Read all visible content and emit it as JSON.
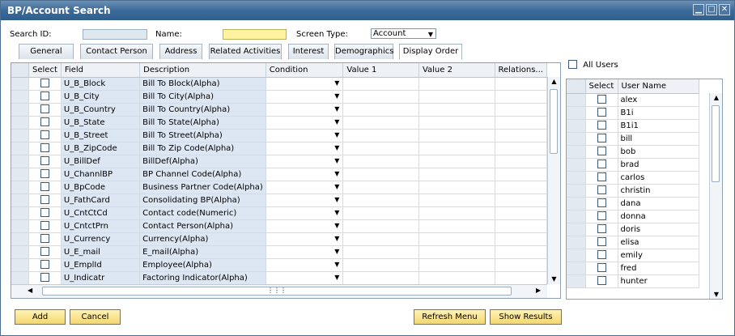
{
  "window": {
    "title": "BP/Account Search"
  },
  "header": {
    "search_id_label": "Search ID:",
    "name_label": "Name:",
    "screen_type_label": "Screen Type:",
    "screen_type_value": "Account"
  },
  "tabs": [
    "General",
    "Contact Person",
    "Address",
    "Related Activities",
    "Interest",
    "Demographics",
    "Display Order"
  ],
  "main_table": {
    "columns": [
      "Select",
      "Field",
      "Description",
      "Condition",
      "Value 1",
      "Value 2",
      "Relations..."
    ],
    "rows": [
      {
        "field": "U_B_Block",
        "description": "Bill To Block(Alpha)"
      },
      {
        "field": "U_B_City",
        "description": "Bill To City(Alpha)"
      },
      {
        "field": "U_B_Country",
        "description": "Bill To Country(Alpha)"
      },
      {
        "field": "U_B_State",
        "description": "Bill To State(Alpha)"
      },
      {
        "field": "U_B_Street",
        "description": "Bill To Street(Alpha)"
      },
      {
        "field": "U_B_ZipCode",
        "description": "Bill To Zip Code(Alpha)"
      },
      {
        "field": "U_BillDef",
        "description": "BillDef(Alpha)"
      },
      {
        "field": "U_ChannlBP",
        "description": "BP Channel Code(Alpha)"
      },
      {
        "field": "U_BpCode",
        "description": "Business Partner Code(Alpha)"
      },
      {
        "field": "U_FathCard",
        "description": "Consolidating BP(Alpha)"
      },
      {
        "field": "U_CntCtCd",
        "description": "Contact code(Numeric)"
      },
      {
        "field": "U_CntctPrn",
        "description": "Contact Person(Alpha)"
      },
      {
        "field": "U_Currency",
        "description": "Currency(Alpha)"
      },
      {
        "field": "U_E_mail",
        "description": "E_mail(Alpha)"
      },
      {
        "field": "U_EmplId",
        "description": "Employee(Alpha)"
      },
      {
        "field": "U_Indicatr",
        "description": "Factoring Indicator(Alpha)"
      }
    ]
  },
  "users": {
    "all_users_label": "All Users",
    "columns": [
      "Select",
      "User Name"
    ],
    "names": [
      "alex",
      "B1i",
      "B1i1",
      "bill",
      "bob",
      "brad",
      "carlos",
      "christin",
      "dana",
      "donna",
      "doris",
      "elisa",
      "emily",
      "fred",
      "hunter"
    ]
  },
  "buttons": {
    "add": "Add",
    "cancel": "Cancel",
    "refresh": "Refresh Menu",
    "show_results": "Show Results"
  },
  "colors": {
    "title_bar": "#2f5d8c",
    "button_yellow": "#f3d76f",
    "field_column_bg": "#dde7f3"
  }
}
